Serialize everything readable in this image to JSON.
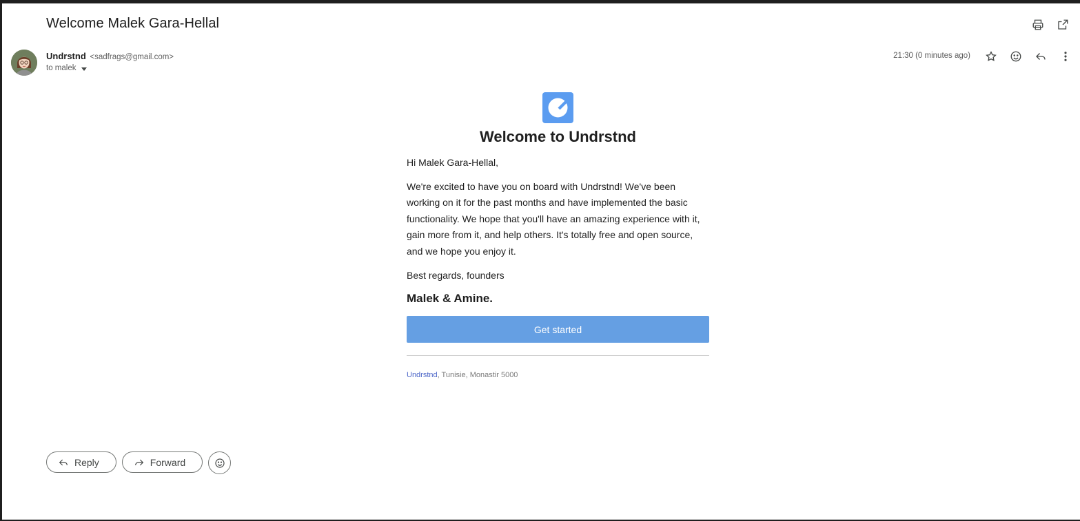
{
  "subject": "Welcome Malek Gara-Hellal",
  "sender": {
    "name": "Undrstnd",
    "email": "<sadfrags@gmail.com>",
    "to": "to malek",
    "time": "21:30 (0 minutes ago)"
  },
  "email_body": {
    "headline": "Welcome to Undrstnd",
    "greeting": "Hi Malek Gara-Hellal,",
    "paragraph": "We're excited to have you on board with Undrstnd! We've been working on it for the past months and have implemented the basic functionality. We hope that you'll have an amazing experience with it, gain more from it, and help others. It's totally free and open source, and we hope you enjoy it.",
    "regards": "Best regards, founders",
    "signature": "Malek & Amine.",
    "cta_label": "Get started",
    "footer_link": "Undrstnd",
    "footer_address": ", Tunisie, Monastir 5000"
  },
  "actions": {
    "reply": "Reply",
    "forward": "Forward"
  },
  "icons": {
    "top": [
      "print-icon",
      "open-in-new-window-icon"
    ],
    "message": [
      "star-icon",
      "emoji-reaction-icon",
      "reply-icon",
      "more-vert-icon"
    ]
  },
  "colors": {
    "brand": "#5b9cf0",
    "cta": "#659fe3",
    "link": "#4a64c7"
  }
}
